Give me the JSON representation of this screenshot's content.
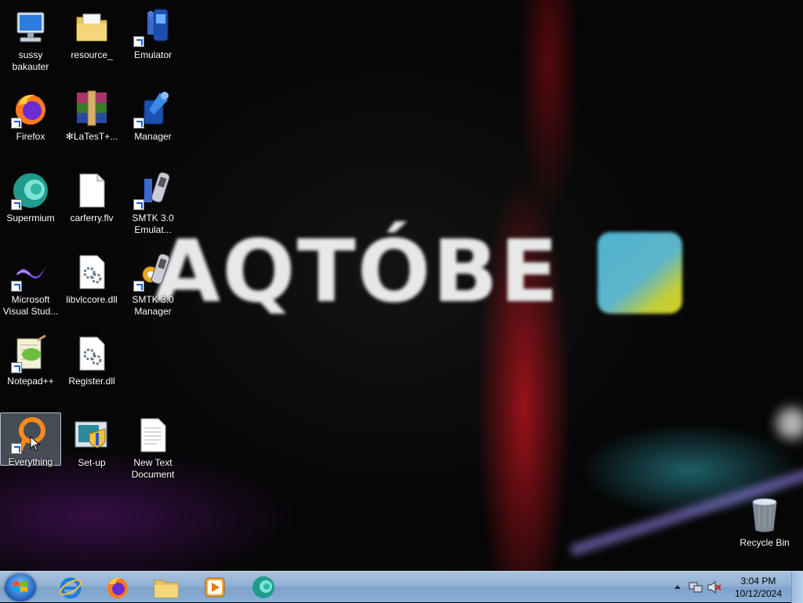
{
  "wallpaper": {
    "text": "AQTÓBE"
  },
  "desktop_icons": {
    "sussy": "sussy bakauter",
    "resource": "resource_",
    "emulator": "Emulator",
    "firefox": "Firefox",
    "latest": "✻LaTesT+...",
    "manager": "Manager",
    "supermium": "Supermium",
    "carferry": "carferry.flv",
    "smtk_emulator": "SMTK 3.0 Emulat...",
    "visual_studio": "Microsoft Visual Stud...",
    "libvlccore": "libvlccore.dll",
    "smtk_manager": "SMTK 3.0 Manager",
    "notepadpp": "Notepad++",
    "register": "Register.dll",
    "everything": "Everything",
    "setup": "Set-up",
    "new_text": "New Text Document",
    "recycle_bin": "Recycle Bin"
  },
  "taskbar": {
    "pinned": [
      "Internet Explorer",
      "Firefox",
      "Windows Explorer",
      "Windows Media Player",
      "Supermium"
    ],
    "clock": {
      "time": "3:04 PM",
      "date": "10/12/2024"
    }
  },
  "colors": {
    "taskbar": "#8fb0d4",
    "selection": "#bed2eb",
    "label_text": "#ffffff"
  }
}
